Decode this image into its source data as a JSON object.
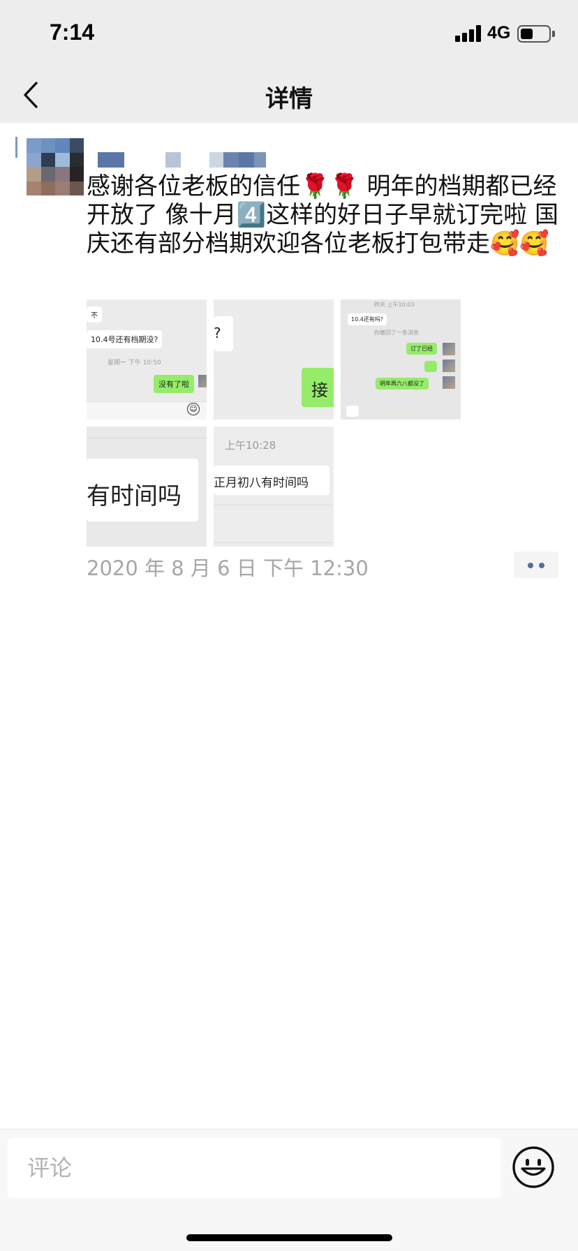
{
  "status_bar": {
    "time": "7:14",
    "network": "4G",
    "icons": [
      "signal-icon",
      "battery-icon"
    ]
  },
  "nav": {
    "title": "详情",
    "back_icon": "chevron-left-icon"
  },
  "post": {
    "text": "感谢各位老板的信任🌹🌹 明年的档期都已经开放了 像十月4️⃣这样的好日子早就订完啦 国庆还有部分档期欢迎各位老板打包带走🥰🥰",
    "timestamp": "2020 年 8 月 6 日 下午 12:30",
    "more_icon": "more-dots-icon",
    "photos": [
      {
        "lines": [
          "不",
          "10.4号还有档期没?",
          "星期一 下午 10:50",
          "没有了啦"
        ],
        "icons": [
          "smile-icon"
        ]
      },
      {
        "lines": [
          "?",
          "接"
        ]
      },
      {
        "lines": [
          "昨天 上午10:03",
          "10.4还有吗?",
          "你撤回了一条消息",
          "订了已经",
          "明年再六八都没了"
        ]
      },
      {
        "lines": [
          "有时间吗"
        ]
      },
      {
        "lines": [
          "上午10:28",
          "正月初八有时间吗"
        ]
      }
    ]
  },
  "comment": {
    "placeholder": "评论",
    "emoji_icon": "smiley-face-icon"
  },
  "colors": {
    "background": "#ffffff",
    "bar_background": "#ededed",
    "link_blue": "#576b95",
    "timestamp_gray": "#a6a6a6",
    "bubble_green": "#95ec69"
  }
}
